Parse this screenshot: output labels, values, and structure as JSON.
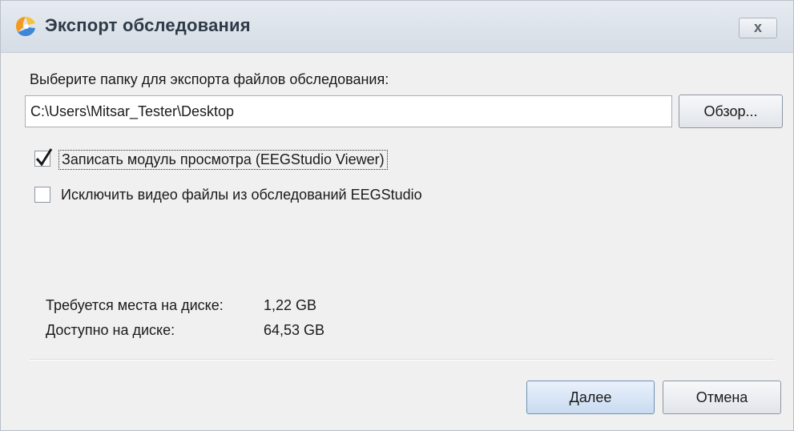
{
  "window": {
    "title": "Экспорт обследования",
    "close_label": "x",
    "icon": "app-logo-icon"
  },
  "export": {
    "folder_label": "Выберите папку для экспорта файлов обследования:",
    "folder_path": "C:\\Users\\Mitsar_Tester\\Desktop",
    "browse_label": "Обзор..."
  },
  "options": {
    "write_viewer": {
      "label": "Записать модуль просмотра (EEGStudio Viewer)",
      "checked": true
    },
    "exclude_video": {
      "label": "Исключить видео файлы из обследований EEGStudio",
      "checked": false
    }
  },
  "disk": {
    "required_label": "Требуется места на диске:",
    "required_value": "1,22 GB",
    "available_label": "Доступно на диске:",
    "available_value": "64,53 GB"
  },
  "buttons": {
    "next_label": "Далее",
    "cancel_label": "Отмена"
  },
  "colors": {
    "titlebar": "#dde3ea",
    "dialog_bg": "#f0f0f0",
    "primary_button": "#c9dbf1"
  }
}
